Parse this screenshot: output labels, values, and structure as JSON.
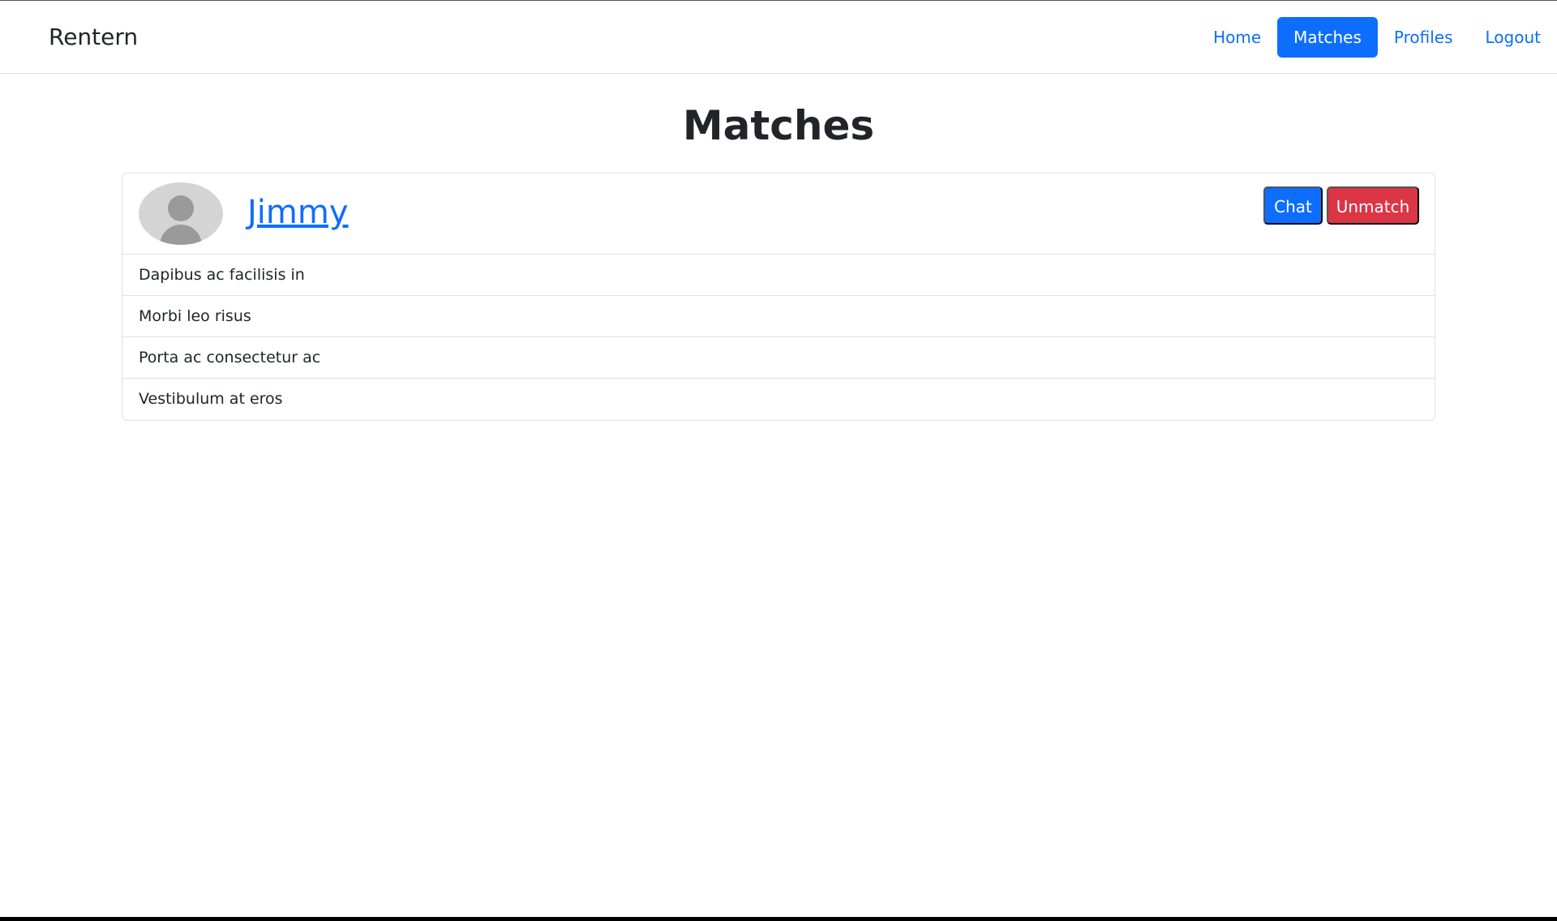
{
  "navbar": {
    "brand": "Rentern",
    "links": [
      {
        "label": "Home",
        "active": false
      },
      {
        "label": "Matches",
        "active": true
      },
      {
        "label": "Profiles",
        "active": false
      },
      {
        "label": "Logout",
        "active": false
      }
    ]
  },
  "main": {
    "title": "Matches",
    "matches": [
      {
        "name": "Jimmy",
        "avatar_icon": "user-avatar-icon",
        "chat_label": "Chat",
        "unmatch_label": "Unmatch",
        "items": [
          "Dapibus ac facilisis in",
          "Morbi leo risus",
          "Porta ac consectetur ac",
          "Vestibulum at eros"
        ]
      }
    ]
  },
  "colors": {
    "primary": "#0d6efd",
    "danger": "#dc3545",
    "text": "#212529",
    "border": "#dee2e6"
  }
}
